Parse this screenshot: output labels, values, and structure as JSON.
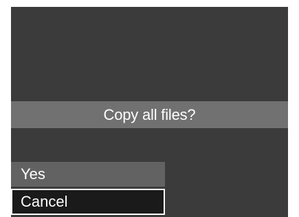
{
  "dialog": {
    "prompt": "Copy all files?",
    "options": [
      {
        "label": "Yes",
        "selected": false
      },
      {
        "label": "Cancel",
        "selected": true
      }
    ]
  },
  "colors": {
    "screen_background": "#3b3b3b",
    "prompt_bar": "#717171",
    "option_background": "#626262",
    "selected_option_background": "#1a1a1a",
    "selected_option_border": "#ffffff",
    "text": "#ffffff"
  }
}
